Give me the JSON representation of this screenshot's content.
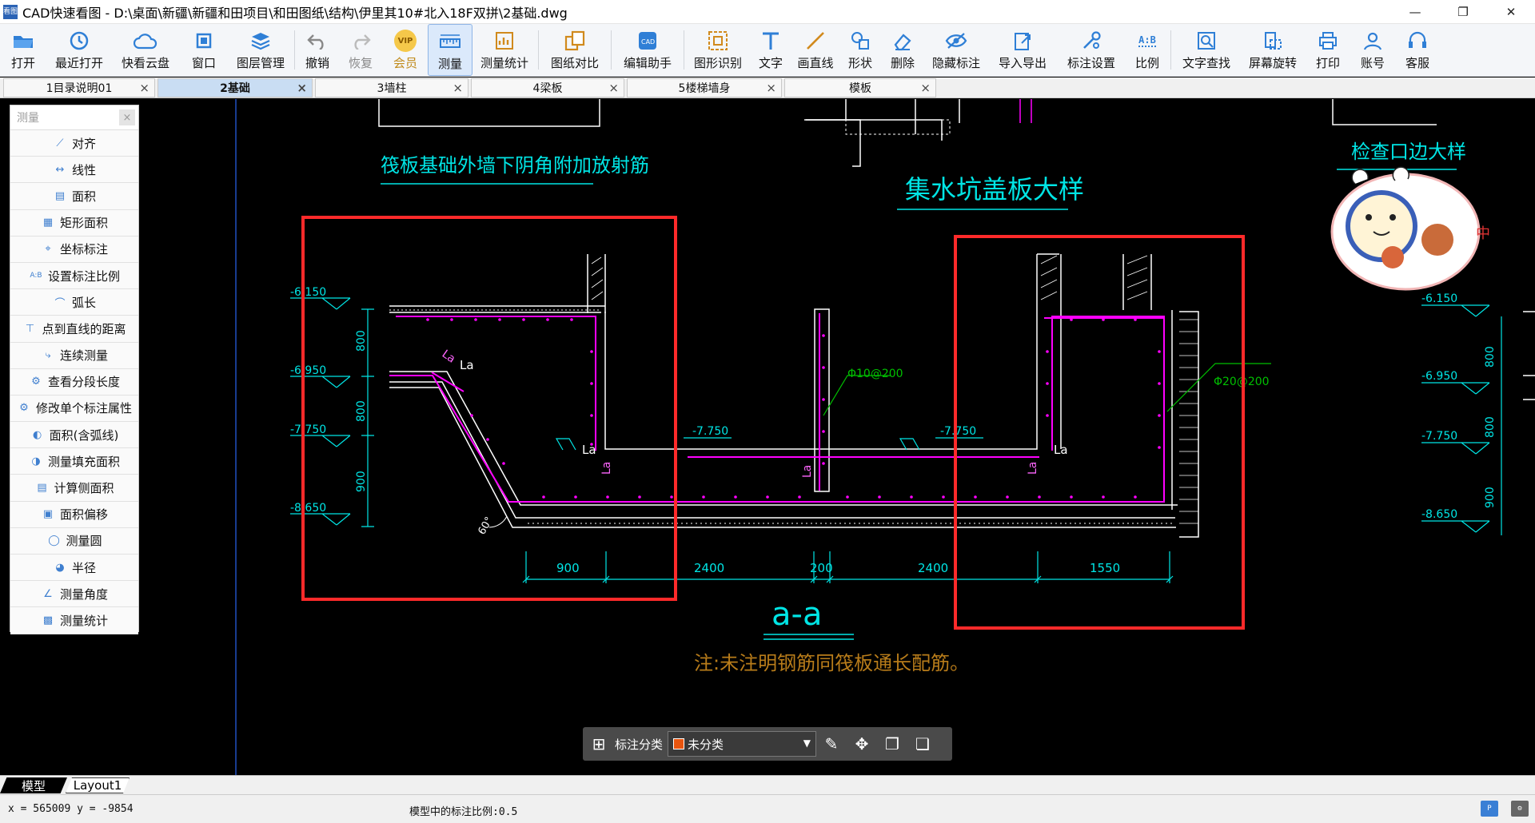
{
  "window": {
    "title": "CAD快速看图 - D:\\桌面\\新疆\\新疆和田项目\\和田图纸\\结构\\伊里其10#北入18F双拼\\2基础.dwg",
    "app_icon_text": "看图"
  },
  "toolbar": {
    "buttons": [
      {
        "label": "打开",
        "icon": "folder-open-icon"
      },
      {
        "label": "最近打开",
        "icon": "recent-clock-icon"
      },
      {
        "label": "快看云盘",
        "icon": "cloud-icon"
      },
      {
        "label": "窗口",
        "icon": "window-icon"
      },
      {
        "label": "图层管理",
        "icon": "layers-icon"
      },
      {
        "label": "撤销",
        "icon": "undo-icon"
      },
      {
        "label": "恢复",
        "icon": "redo-icon"
      },
      {
        "label": "会员",
        "icon": "vip-icon"
      },
      {
        "label": "测量",
        "icon": "ruler-icon"
      },
      {
        "label": "测量统计",
        "icon": "measure-stats-icon"
      },
      {
        "label": "图纸对比",
        "icon": "compare-icon"
      },
      {
        "label": "编辑助手",
        "icon": "cad-edit-icon"
      },
      {
        "label": "图形识别",
        "icon": "shape-recognize-icon"
      },
      {
        "label": "文字",
        "icon": "text-icon"
      },
      {
        "label": "画直线",
        "icon": "line-icon"
      },
      {
        "label": "形状",
        "icon": "shape-icon"
      },
      {
        "label": "删除",
        "icon": "eraser-icon"
      },
      {
        "label": "隐藏标注",
        "icon": "hide-eye-icon"
      },
      {
        "label": "导入导出",
        "icon": "import-export-icon"
      },
      {
        "label": "标注设置",
        "icon": "annotation-settings-icon"
      },
      {
        "label": "比例",
        "icon": "scale-ratio-icon"
      },
      {
        "label": "文字查找",
        "icon": "text-search-icon"
      },
      {
        "label": "屏幕旋转",
        "icon": "rotate-screen-icon"
      },
      {
        "label": "打印",
        "icon": "printer-icon"
      },
      {
        "label": "账号",
        "icon": "account-icon"
      },
      {
        "label": "客服",
        "icon": "headset-icon"
      }
    ],
    "vip_badge": "VIP",
    "scale_badge": "A:B"
  },
  "tabs": [
    {
      "label": "1目录说明01"
    },
    {
      "label": "2基础"
    },
    {
      "label": "3墙柱"
    },
    {
      "label": "4梁板"
    },
    {
      "label": "5楼梯墙身"
    },
    {
      "label": "模板"
    }
  ],
  "measure_panel": {
    "title": "测量",
    "close": "×",
    "items": [
      {
        "label": "对齐",
        "icon": "align-measure-icon"
      },
      {
        "label": "线性",
        "icon": "linear-measure-icon"
      },
      {
        "label": "面积",
        "icon": "area-icon"
      },
      {
        "label": "矩形面积",
        "icon": "rect-area-icon"
      },
      {
        "label": "坐标标注",
        "icon": "coordinate-icon"
      },
      {
        "label": "设置标注比例",
        "icon": "set-scale-icon"
      },
      {
        "label": "弧长",
        "icon": "arc-length-icon"
      },
      {
        "label": "点到直线的距离",
        "icon": "point-line-distance-icon"
      },
      {
        "label": "连续测量",
        "icon": "continuous-measure-icon"
      },
      {
        "label": "查看分段长度",
        "icon": "segment-length-icon"
      },
      {
        "label": "修改单个标注属性",
        "icon": "edit-annotation-icon"
      },
      {
        "label": "面积(含弧线)",
        "icon": "arc-area-icon"
      },
      {
        "label": "测量填充面积",
        "icon": "fill-area-icon"
      },
      {
        "label": "计算侧面积",
        "icon": "side-area-icon"
      },
      {
        "label": "面积偏移",
        "icon": "area-offset-icon"
      },
      {
        "label": "测量圆",
        "icon": "circle-measure-icon"
      },
      {
        "label": "半径",
        "icon": "radius-icon"
      },
      {
        "label": "测量角度",
        "icon": "angle-icon"
      },
      {
        "label": "测量统计",
        "icon": "measure-stats-icon"
      }
    ]
  },
  "drawing": {
    "texts": {
      "title_left": "筏板基础外墙下阴角附加放射筋",
      "title_center": "集水坑盖板大样",
      "title_right": "检查口边大样",
      "section_label": "a-a",
      "note": "注:未注明钢筋同筏板通长配筋。",
      "elev_1": "-6.150",
      "elev_2": "-6.950",
      "elev_3": "-7.750",
      "elev_4": "-8.650",
      "dim_v_1": "800",
      "dim_v_2": "800",
      "dim_v_3": "900",
      "dim_h_1": "900",
      "dim_h_2": "2400",
      "dim_h_3": "200",
      "dim_h_4": "2400",
      "dim_h_5": "1550",
      "lev_mid_1": "-7.750",
      "lev_mid_2": "-7.750",
      "rebar_1": "Φ10@200",
      "rebar_2": "Φ20@200",
      "la": "La",
      "angle": "60°",
      "sticker": "中"
    },
    "colors": {
      "background": "#000000",
      "cyan": "#00e5e5",
      "magenta": "#ff00ff",
      "white": "#ffffff",
      "green": "#00c000",
      "red_highlight": "#ff2a2a",
      "orange_note": "#b87c1a"
    }
  },
  "annotation_bar": {
    "label": "标注分类",
    "selected": "未分类",
    "swatch_color": "#e8550f"
  },
  "layout_tabs": [
    "模型",
    "Layout1"
  ],
  "status": {
    "coords": "x = 565009 y = -9854",
    "scale": "模型中的标注比例:0.5"
  }
}
